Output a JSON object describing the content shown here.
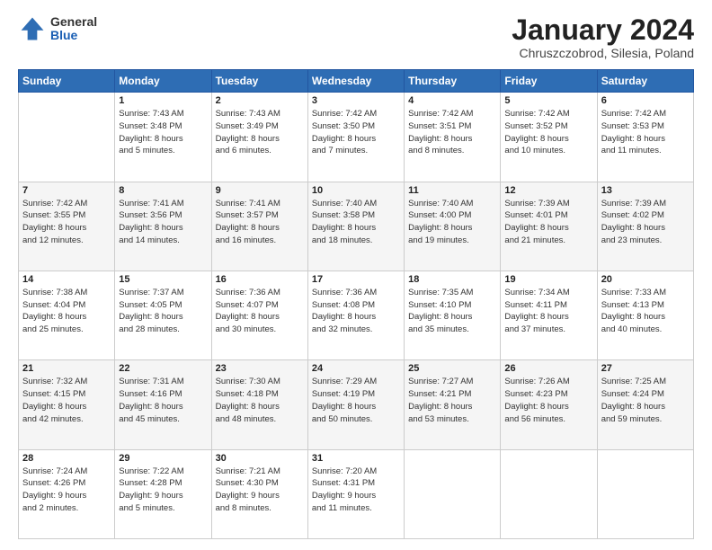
{
  "header": {
    "logo_general": "General",
    "logo_blue": "Blue",
    "main_title": "January 2024",
    "subtitle": "Chruszczobrod, Silesia, Poland"
  },
  "days_of_week": [
    "Sunday",
    "Monday",
    "Tuesday",
    "Wednesday",
    "Thursday",
    "Friday",
    "Saturday"
  ],
  "weeks": [
    [
      {
        "day": "",
        "info": ""
      },
      {
        "day": "1",
        "info": "Sunrise: 7:43 AM\nSunset: 3:48 PM\nDaylight: 8 hours\nand 5 minutes."
      },
      {
        "day": "2",
        "info": "Sunrise: 7:43 AM\nSunset: 3:49 PM\nDaylight: 8 hours\nand 6 minutes."
      },
      {
        "day": "3",
        "info": "Sunrise: 7:42 AM\nSunset: 3:50 PM\nDaylight: 8 hours\nand 7 minutes."
      },
      {
        "day": "4",
        "info": "Sunrise: 7:42 AM\nSunset: 3:51 PM\nDaylight: 8 hours\nand 8 minutes."
      },
      {
        "day": "5",
        "info": "Sunrise: 7:42 AM\nSunset: 3:52 PM\nDaylight: 8 hours\nand 10 minutes."
      },
      {
        "day": "6",
        "info": "Sunrise: 7:42 AM\nSunset: 3:53 PM\nDaylight: 8 hours\nand 11 minutes."
      }
    ],
    [
      {
        "day": "7",
        "info": "Sunrise: 7:42 AM\nSunset: 3:55 PM\nDaylight: 8 hours\nand 12 minutes."
      },
      {
        "day": "8",
        "info": "Sunrise: 7:41 AM\nSunset: 3:56 PM\nDaylight: 8 hours\nand 14 minutes."
      },
      {
        "day": "9",
        "info": "Sunrise: 7:41 AM\nSunset: 3:57 PM\nDaylight: 8 hours\nand 16 minutes."
      },
      {
        "day": "10",
        "info": "Sunrise: 7:40 AM\nSunset: 3:58 PM\nDaylight: 8 hours\nand 18 minutes."
      },
      {
        "day": "11",
        "info": "Sunrise: 7:40 AM\nSunset: 4:00 PM\nDaylight: 8 hours\nand 19 minutes."
      },
      {
        "day": "12",
        "info": "Sunrise: 7:39 AM\nSunset: 4:01 PM\nDaylight: 8 hours\nand 21 minutes."
      },
      {
        "day": "13",
        "info": "Sunrise: 7:39 AM\nSunset: 4:02 PM\nDaylight: 8 hours\nand 23 minutes."
      }
    ],
    [
      {
        "day": "14",
        "info": "Sunrise: 7:38 AM\nSunset: 4:04 PM\nDaylight: 8 hours\nand 25 minutes."
      },
      {
        "day": "15",
        "info": "Sunrise: 7:37 AM\nSunset: 4:05 PM\nDaylight: 8 hours\nand 28 minutes."
      },
      {
        "day": "16",
        "info": "Sunrise: 7:36 AM\nSunset: 4:07 PM\nDaylight: 8 hours\nand 30 minutes."
      },
      {
        "day": "17",
        "info": "Sunrise: 7:36 AM\nSunset: 4:08 PM\nDaylight: 8 hours\nand 32 minutes."
      },
      {
        "day": "18",
        "info": "Sunrise: 7:35 AM\nSunset: 4:10 PM\nDaylight: 8 hours\nand 35 minutes."
      },
      {
        "day": "19",
        "info": "Sunrise: 7:34 AM\nSunset: 4:11 PM\nDaylight: 8 hours\nand 37 minutes."
      },
      {
        "day": "20",
        "info": "Sunrise: 7:33 AM\nSunset: 4:13 PM\nDaylight: 8 hours\nand 40 minutes."
      }
    ],
    [
      {
        "day": "21",
        "info": "Sunrise: 7:32 AM\nSunset: 4:15 PM\nDaylight: 8 hours\nand 42 minutes."
      },
      {
        "day": "22",
        "info": "Sunrise: 7:31 AM\nSunset: 4:16 PM\nDaylight: 8 hours\nand 45 minutes."
      },
      {
        "day": "23",
        "info": "Sunrise: 7:30 AM\nSunset: 4:18 PM\nDaylight: 8 hours\nand 48 minutes."
      },
      {
        "day": "24",
        "info": "Sunrise: 7:29 AM\nSunset: 4:19 PM\nDaylight: 8 hours\nand 50 minutes."
      },
      {
        "day": "25",
        "info": "Sunrise: 7:27 AM\nSunset: 4:21 PM\nDaylight: 8 hours\nand 53 minutes."
      },
      {
        "day": "26",
        "info": "Sunrise: 7:26 AM\nSunset: 4:23 PM\nDaylight: 8 hours\nand 56 minutes."
      },
      {
        "day": "27",
        "info": "Sunrise: 7:25 AM\nSunset: 4:24 PM\nDaylight: 8 hours\nand 59 minutes."
      }
    ],
    [
      {
        "day": "28",
        "info": "Sunrise: 7:24 AM\nSunset: 4:26 PM\nDaylight: 9 hours\nand 2 minutes."
      },
      {
        "day": "29",
        "info": "Sunrise: 7:22 AM\nSunset: 4:28 PM\nDaylight: 9 hours\nand 5 minutes."
      },
      {
        "day": "30",
        "info": "Sunrise: 7:21 AM\nSunset: 4:30 PM\nDaylight: 9 hours\nand 8 minutes."
      },
      {
        "day": "31",
        "info": "Sunrise: 7:20 AM\nSunset: 4:31 PM\nDaylight: 9 hours\nand 11 minutes."
      },
      {
        "day": "",
        "info": ""
      },
      {
        "day": "",
        "info": ""
      },
      {
        "day": "",
        "info": ""
      }
    ]
  ]
}
